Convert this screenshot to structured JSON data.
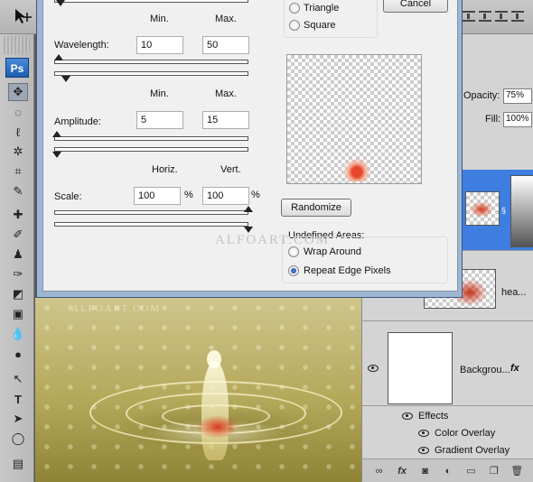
{
  "app": {
    "logo": "Ps",
    "options_bar": {
      "tool_icon": "move-tool-icon"
    }
  },
  "dialog": {
    "cancel_label": "Cancel",
    "type_options": [
      "Triangle",
      "Square"
    ],
    "wavelength": {
      "label": "Wavelength:",
      "min_header": "Min.",
      "max_header": "Max.",
      "min": "10",
      "max": "50"
    },
    "amplitude": {
      "label": "Amplitude:",
      "min_header": "Min.",
      "max_header": "Max.",
      "min": "5",
      "max": "15"
    },
    "scale": {
      "label": "Scale:",
      "horiz_header": "Horiz.",
      "vert_header": "Vert.",
      "horiz": "100",
      "vert": "100",
      "unit": "%"
    },
    "randomize_label": "Randomize",
    "undefined_areas": {
      "title": "Undefined Areas:",
      "options": [
        "Wrap Around",
        "Repeat Edge Pixels"
      ],
      "selected": "Repeat Edge Pixels"
    },
    "watermark": "ALFOART.COM"
  },
  "canvas": {
    "watermark": "ALFOART.COM"
  },
  "layers_panel": {
    "opacity_label": "Opacity:",
    "opacity_value": "75%",
    "fill_label": "Fill:",
    "fill_value": "100%",
    "layers": [
      {
        "name": "hea..."
      },
      {
        "name": "Backgrou...",
        "fx": "fx"
      }
    ],
    "effects_label": "Effects",
    "effects": [
      "Color Overlay",
      "Gradient Overlay"
    ]
  },
  "colors": {
    "selection_blue": "#3d7ee0",
    "dialog_frame": "#9fb6d3"
  }
}
